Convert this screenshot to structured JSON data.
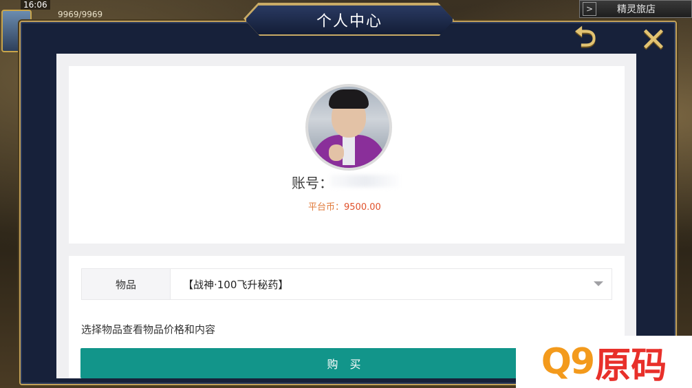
{
  "hud": {
    "time": "16:06",
    "hp": "9969/9969",
    "shop_label": "精灵旅店"
  },
  "modal": {
    "title": "个人中心"
  },
  "profile": {
    "account_label": "账号：",
    "coin_label": "平台币：",
    "coin_value": "9500.00"
  },
  "purchase": {
    "item_label": "物品",
    "selected_item": "【战神·100飞升秘药】",
    "hint": "选择物品查看物品价格和内容",
    "buy_label": "购 买"
  },
  "watermark": {
    "brand_q9": "Q9",
    "brand_text": "原码"
  },
  "colors": {
    "accent_teal": "#12958a",
    "coin_orange": "#e07a3a",
    "frame_navy": "#17213a",
    "frame_gold": "#c2a15a"
  }
}
